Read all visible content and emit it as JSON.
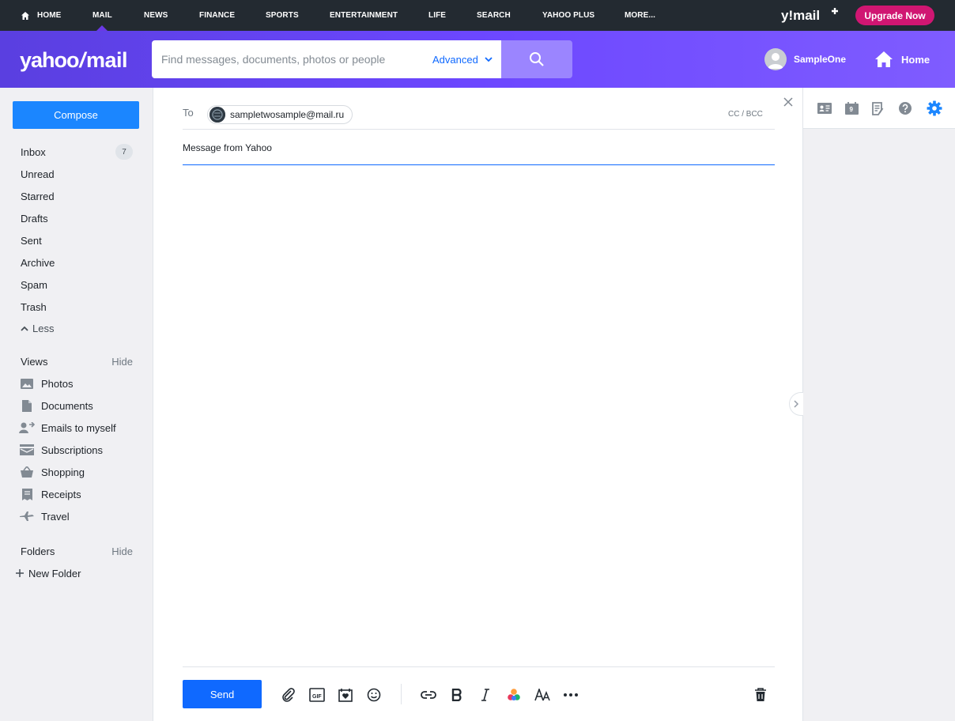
{
  "topnav": {
    "items": [
      {
        "label": "HOME"
      },
      {
        "label": "MAIL"
      },
      {
        "label": "NEWS"
      },
      {
        "label": "FINANCE"
      },
      {
        "label": "SPORTS"
      },
      {
        "label": "ENTERTAINMENT"
      },
      {
        "label": "LIFE"
      },
      {
        "label": "SEARCH"
      },
      {
        "label": "YAHOO PLUS"
      },
      {
        "label": "MORE..."
      }
    ],
    "active": "MAIL",
    "brand": "y!mail+",
    "upgrade_label": "Upgrade Now"
  },
  "header": {
    "logo_yahoo": "yahoo",
    "logo_slash": "/",
    "logo_mail": "mail",
    "search_placeholder": "Find messages, documents, photos or people",
    "advanced_label": "Advanced",
    "user_name": "SampleOne",
    "home_label": "Home"
  },
  "sidebar": {
    "compose_label": "Compose",
    "folders": [
      {
        "label": "Inbox",
        "count": "7"
      },
      {
        "label": "Unread"
      },
      {
        "label": "Starred"
      },
      {
        "label": "Drafts"
      },
      {
        "label": "Sent"
      },
      {
        "label": "Archive"
      },
      {
        "label": "Spam"
      },
      {
        "label": "Trash"
      }
    ],
    "less_label": "Less",
    "views_title": "Views",
    "views_hide": "Hide",
    "views": [
      {
        "label": "Photos",
        "icon": "photos-icon"
      },
      {
        "label": "Documents",
        "icon": "documents-icon"
      },
      {
        "label": "Emails to myself",
        "icon": "emails-to-myself-icon"
      },
      {
        "label": "Subscriptions",
        "icon": "subscriptions-icon"
      },
      {
        "label": "Shopping",
        "icon": "shopping-icon"
      },
      {
        "label": "Receipts",
        "icon": "receipts-icon"
      },
      {
        "label": "Travel",
        "icon": "travel-icon"
      }
    ],
    "folders_title": "Folders",
    "folders_hide": "Hide",
    "new_folder_label": "New Folder"
  },
  "compose": {
    "to_label": "To",
    "recipient": "sampletwosample@mail.ru",
    "cc_bcc_label": "CC / BCC",
    "subject": "Message from Yahoo",
    "send_label": "Send",
    "toolbar": [
      "attach-icon",
      "gif-icon",
      "stationery-icon",
      "emoji-icon",
      "link-icon",
      "bold-icon",
      "italic-icon",
      "color-icon",
      "font-size-icon",
      "more-icon",
      "delete-draft-icon"
    ]
  },
  "colors": {
    "accent": "#0f69ff",
    "header": "#6c47ff",
    "topnav": "#232a31",
    "upgrade": "#d01672"
  }
}
